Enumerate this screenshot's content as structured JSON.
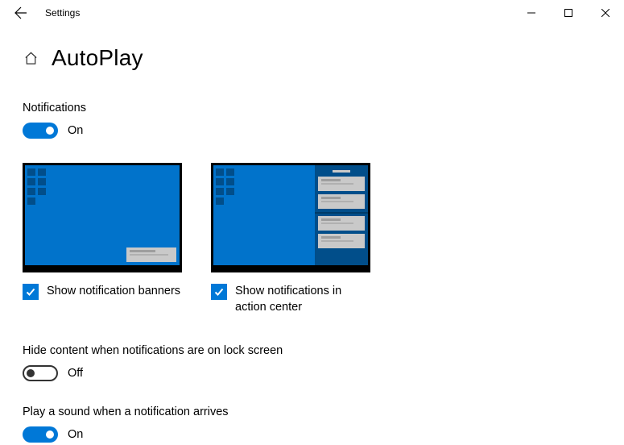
{
  "window": {
    "title": "Settings"
  },
  "page": {
    "title": "AutoPlay"
  },
  "notifications": {
    "label": "Notifications",
    "toggle_state": "On"
  },
  "options": {
    "banners_label": "Show notification banners",
    "action_center_label": "Show notifications in action center"
  },
  "hide_content": {
    "label": "Hide content when notifications are on lock screen",
    "toggle_state": "Off"
  },
  "play_sound": {
    "label": "Play a sound when a notification arrives",
    "toggle_state": "On"
  }
}
